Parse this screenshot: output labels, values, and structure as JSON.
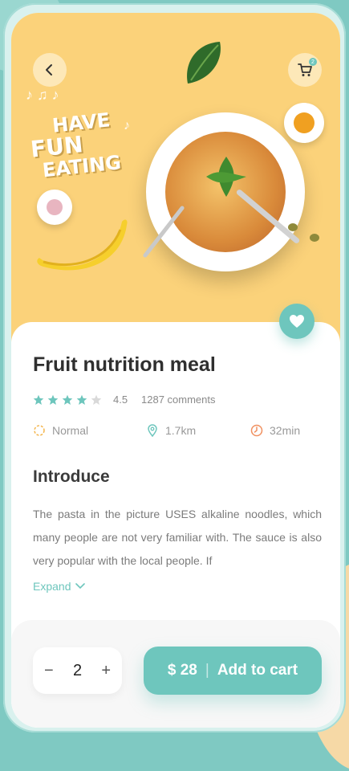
{
  "hero": {
    "slogan": [
      "HAVE",
      "FUN",
      "EATING"
    ],
    "cart_count": "2"
  },
  "product": {
    "title": "Fruit nutrition meal",
    "rating": "4.5",
    "stars": 4,
    "comments": "1287 comments",
    "meta": {
      "level": "Normal",
      "distance": "1.7km",
      "time": "32min"
    }
  },
  "intro": {
    "heading": "Introduce",
    "text": "The pasta in the picture USES alkaline noodles, which many people are not very familiar with. The sauce is also very popular with the local people. If",
    "expand_label": "Expand"
  },
  "order": {
    "quantity": "2",
    "minus": "−",
    "plus": "+",
    "price": "$ 28",
    "separator": "|",
    "cta": "Add to cart"
  },
  "colors": {
    "accent": "#6ec6bd",
    "hero_bg": "#fbd27a"
  }
}
